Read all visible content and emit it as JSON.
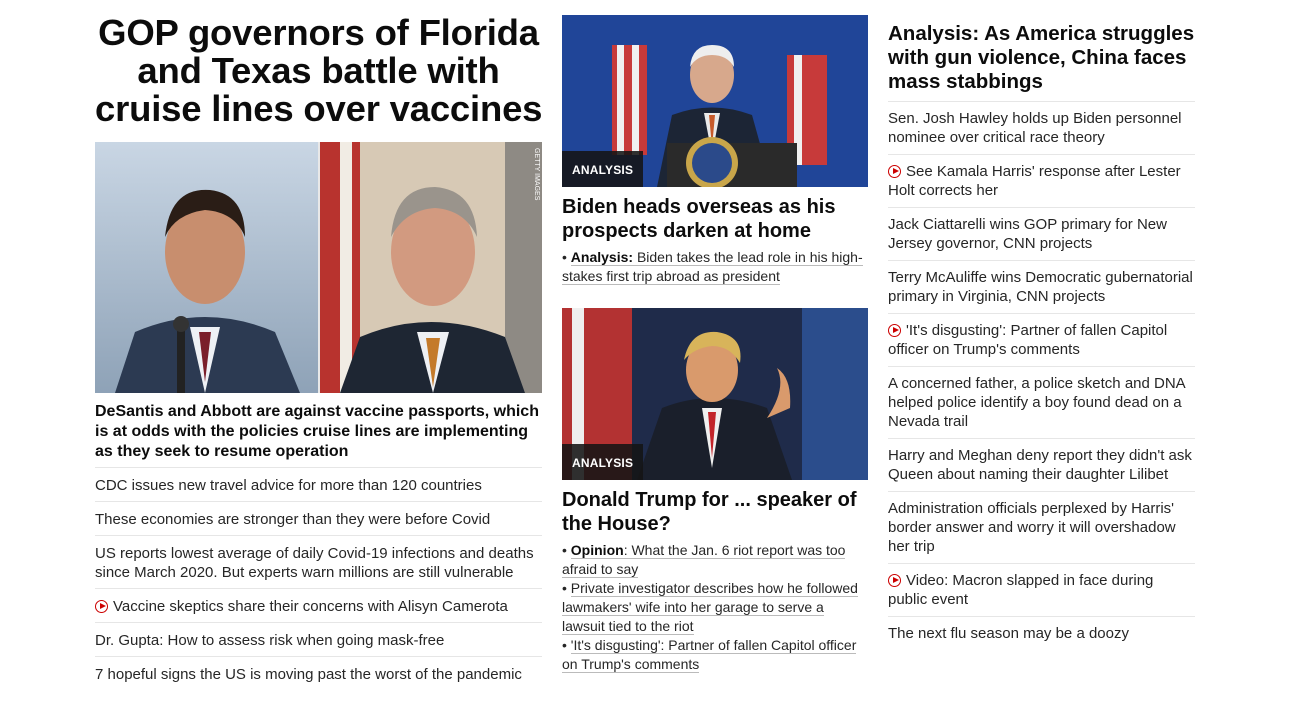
{
  "col1": {
    "headline_lines": [
      "GOP governors of Florida",
      "and Texas battle with",
      "cruise lines over vaccines"
    ],
    "image_credit": "GETTY IMAGES",
    "subheadline": "DeSantis and Abbott are against vaccine passports, which is at odds with the policies cruise lines are implementing as they seek to resume operation",
    "links": [
      {
        "text": "CDC issues new travel advice for more than 120 countries",
        "video": false
      },
      {
        "text": "These economies are stronger than they were before Covid",
        "video": false
      },
      {
        "text": "US reports lowest average of daily Covid-19 infections and deaths since March 2020. But experts warn millions are still vulnerable",
        "video": false
      },
      {
        "text": "Vaccine skeptics share their concerns with Alisyn Camerota",
        "video": true
      },
      {
        "text": "Dr. Gupta: How to assess risk when going mask-free",
        "video": false
      },
      {
        "text": "7 hopeful signs the US is moving past the worst of the pandemic",
        "video": false
      }
    ]
  },
  "col2": {
    "card1": {
      "badge": "ANALYSIS",
      "title": "Biden heads overseas as his prospects darken at home",
      "bullet_prefix": "Analysis:",
      "bullet_text": "Biden takes the lead role in his high-stakes first trip abroad as president"
    },
    "card2": {
      "badge": "ANALYSIS",
      "title": "Donald Trump for ... speaker of the House?",
      "bullet1_prefix": "Opinion",
      "bullet1_text": ": What the Jan. 6 riot report was too afraid to say",
      "bullet2_text": "Private investigator describes how he followed lawmakers' wife into her garage to serve a lawsuit tied to the riot",
      "bullet3_text": "'It's disgusting': Partner of fallen Capitol officer on Trump's comments"
    }
  },
  "col3": {
    "headline": "Analysis: As America struggles with gun violence, China faces mass stabbings",
    "links": [
      {
        "text": "Sen. Josh Hawley holds up Biden personnel nominee over critical race theory",
        "video": false
      },
      {
        "text": "See Kamala Harris' response after Lester Holt corrects her",
        "video": true
      },
      {
        "text": "Jack Ciattarelli wins GOP primary for New Jersey governor, CNN projects",
        "video": false
      },
      {
        "text": "Terry McAuliffe wins Democratic gubernatorial primary in Virginia, CNN projects",
        "video": false
      },
      {
        "text": "'It's disgusting': Partner of fallen Capitol officer on Trump's comments",
        "video": true
      },
      {
        "text": "A concerned father, a police sketch and DNA helped police identify a boy found dead on a Nevada trail",
        "video": false
      },
      {
        "text": "Harry and Meghan deny report they didn't ask Queen about naming their daughter Lilibet",
        "video": false
      },
      {
        "text": "Administration officials perplexed by Harris' border answer and worry it will overshadow her trip",
        "video": false
      },
      {
        "text": "Video: Macron slapped in face during public event",
        "video": true
      },
      {
        "text": "The next flu season may be a doozy",
        "video": false
      }
    ]
  },
  "colors": {
    "video_red": "#cc0000",
    "text": "#262626",
    "divider": "#e6e6e6"
  }
}
